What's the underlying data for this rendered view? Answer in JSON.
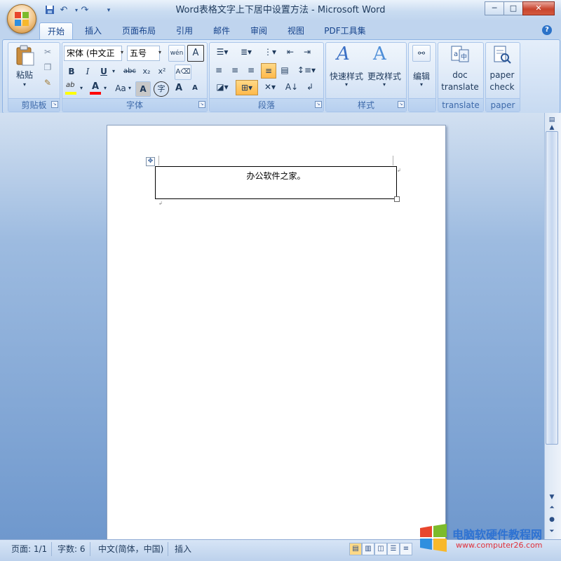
{
  "window": {
    "title": "Word表格文字上下居中设置方法 - Microsoft Word",
    "minimize_glyph": "─",
    "maximize_glyph": "□",
    "close_glyph": "✕"
  },
  "quick_access": {
    "save_icon": "save-icon",
    "undo_icon": "undo-icon",
    "redo_icon": "redo-icon",
    "customize_icon": "dropdown-icon"
  },
  "tabs": [
    "开始",
    "插入",
    "页面布局",
    "引用",
    "邮件",
    "审阅",
    "视图",
    "PDF工具集"
  ],
  "help_glyph": "?",
  "ribbon": {
    "clipboard": {
      "label": "剪贴板",
      "paste_label": "粘贴"
    },
    "font": {
      "label": "字体",
      "font_name": "宋体 (中文正",
      "font_size": "五号",
      "bold": "B",
      "italic": "I",
      "underline": "U",
      "strikethrough": "abc",
      "subscript": "x₂",
      "superscript": "x²",
      "change_case": "Aa",
      "grow": "A",
      "shrink": "A",
      "phonetic": "wén",
      "char_border": "A",
      "char_shading": "A",
      "enclose": "字",
      "clear_format_icon": "clear-format-icon"
    },
    "paragraph": {
      "label": "段落"
    },
    "styles": {
      "label": "样式",
      "quick_styles": "快速样式",
      "change_styles": "更改样式"
    },
    "editing": {
      "label": "编辑"
    },
    "translate": {
      "label": "translate",
      "doc": "doc",
      "translate_word": "translate"
    },
    "paper": {
      "label": "paper",
      "paper_word": "paper",
      "check": "check"
    }
  },
  "document": {
    "cell_text": "办公软件之家。"
  },
  "status_bar": {
    "page": "页面: 1/1",
    "word_count": "字数: 6",
    "language": "中文(简体，中国)",
    "insert_mode": "插入"
  },
  "watermark": {
    "text": "电脑软硬件教程网",
    "url": "www.computer26.com"
  },
  "colors": {
    "accent": "#15428b",
    "ribbon_bg": "#dbe6f5",
    "highlight": "#ffff00",
    "font_color": "#ff0000"
  }
}
